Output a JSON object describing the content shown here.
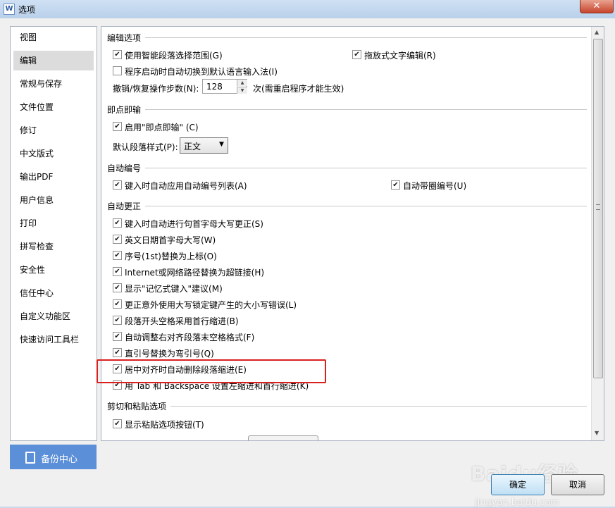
{
  "window": {
    "title": "选项",
    "app_icon_glyph": "W",
    "close_glyph": "✕"
  },
  "sidebar": {
    "items": [
      {
        "label": "视图"
      },
      {
        "label": "编辑",
        "selected": true
      },
      {
        "label": "常规与保存"
      },
      {
        "label": "文件位置"
      },
      {
        "label": "修订"
      },
      {
        "label": "中文版式"
      },
      {
        "label": "输出PDF"
      },
      {
        "label": "用户信息"
      },
      {
        "label": "打印"
      },
      {
        "label": "拼写检查"
      },
      {
        "label": "安全性"
      },
      {
        "label": "信任中心"
      },
      {
        "label": "自定义功能区"
      },
      {
        "label": "快速访问工具栏"
      }
    ],
    "backup_button": "备份中心"
  },
  "sections": {
    "edit": {
      "title": "编辑选项",
      "smart_select": {
        "label": "使用智能段落选择范围(G)",
        "checked": true
      },
      "drag_text": {
        "label": "拖放式文字编辑(R)",
        "checked": true
      },
      "auto_ime": {
        "label": "程序启动时自动切换到默认语言输入法(I)",
        "checked": false
      },
      "undo_label": "撤销/恢复操作步数(N):",
      "undo_value": "128",
      "undo_note": "次(需重启程序才能生效)"
    },
    "click_type": {
      "title": "即点即输",
      "enable": {
        "label": "启用\"即点即输\" (C)",
        "checked": true
      },
      "style_label": "默认段落样式(P):",
      "style_value": "正文"
    },
    "auto_number": {
      "title": "自动编号",
      "auto_list": {
        "label": "键入时自动应用自动编号列表(A)",
        "checked": true
      },
      "circled": {
        "label": "自动带圈编号(U)",
        "checked": true
      }
    },
    "autocorrect": {
      "title": "自动更正",
      "items": [
        {
          "label": "键入时自动进行句首字母大写更正(S)",
          "checked": true
        },
        {
          "label": "英文日期首字母大写(W)",
          "checked": true
        },
        {
          "label": "序号(1st)替换为上标(O)",
          "checked": true
        },
        {
          "label": "Internet或网络路径替换为超链接(H)",
          "checked": true
        },
        {
          "label": "显示\"记忆式键入\"建议(M)",
          "checked": true
        },
        {
          "label": "更正意外使用大写锁定键产生的大小写错误(L)",
          "checked": true
        },
        {
          "label": "段落开头空格采用首行缩进(B)",
          "checked": true
        },
        {
          "label": "自动调整右对齐段落末空格格式(F)",
          "checked": true
        },
        {
          "label": "直引号替换为弯引号(Q)",
          "checked": true
        },
        {
          "label": "居中对齐时自动删除段落缩进(E)",
          "checked": true
        },
        {
          "label": "用 Tab 和 Backspace 设置左缩进和首行缩进(K)",
          "checked": true
        }
      ]
    },
    "paste": {
      "title": "剪切和粘贴选项",
      "show_button": {
        "label": "显示粘贴选项按钮(T)",
        "checked": true
      }
    }
  },
  "glyphs": {
    "check": "✔",
    "spin_up": "▲",
    "spin_down": "▼",
    "dropdown": "▼",
    "scroll_up": "▲",
    "scroll_down": "▼"
  },
  "footer": {
    "ok": "确定",
    "cancel": "取消"
  },
  "watermark": {
    "main": "Baidu经验",
    "sub": "jingyan.baidu.com"
  },
  "colors": {
    "highlight": "#d9201f",
    "backup_bg": "#5b8fd8",
    "selected_bg": "#dcdcdc"
  }
}
